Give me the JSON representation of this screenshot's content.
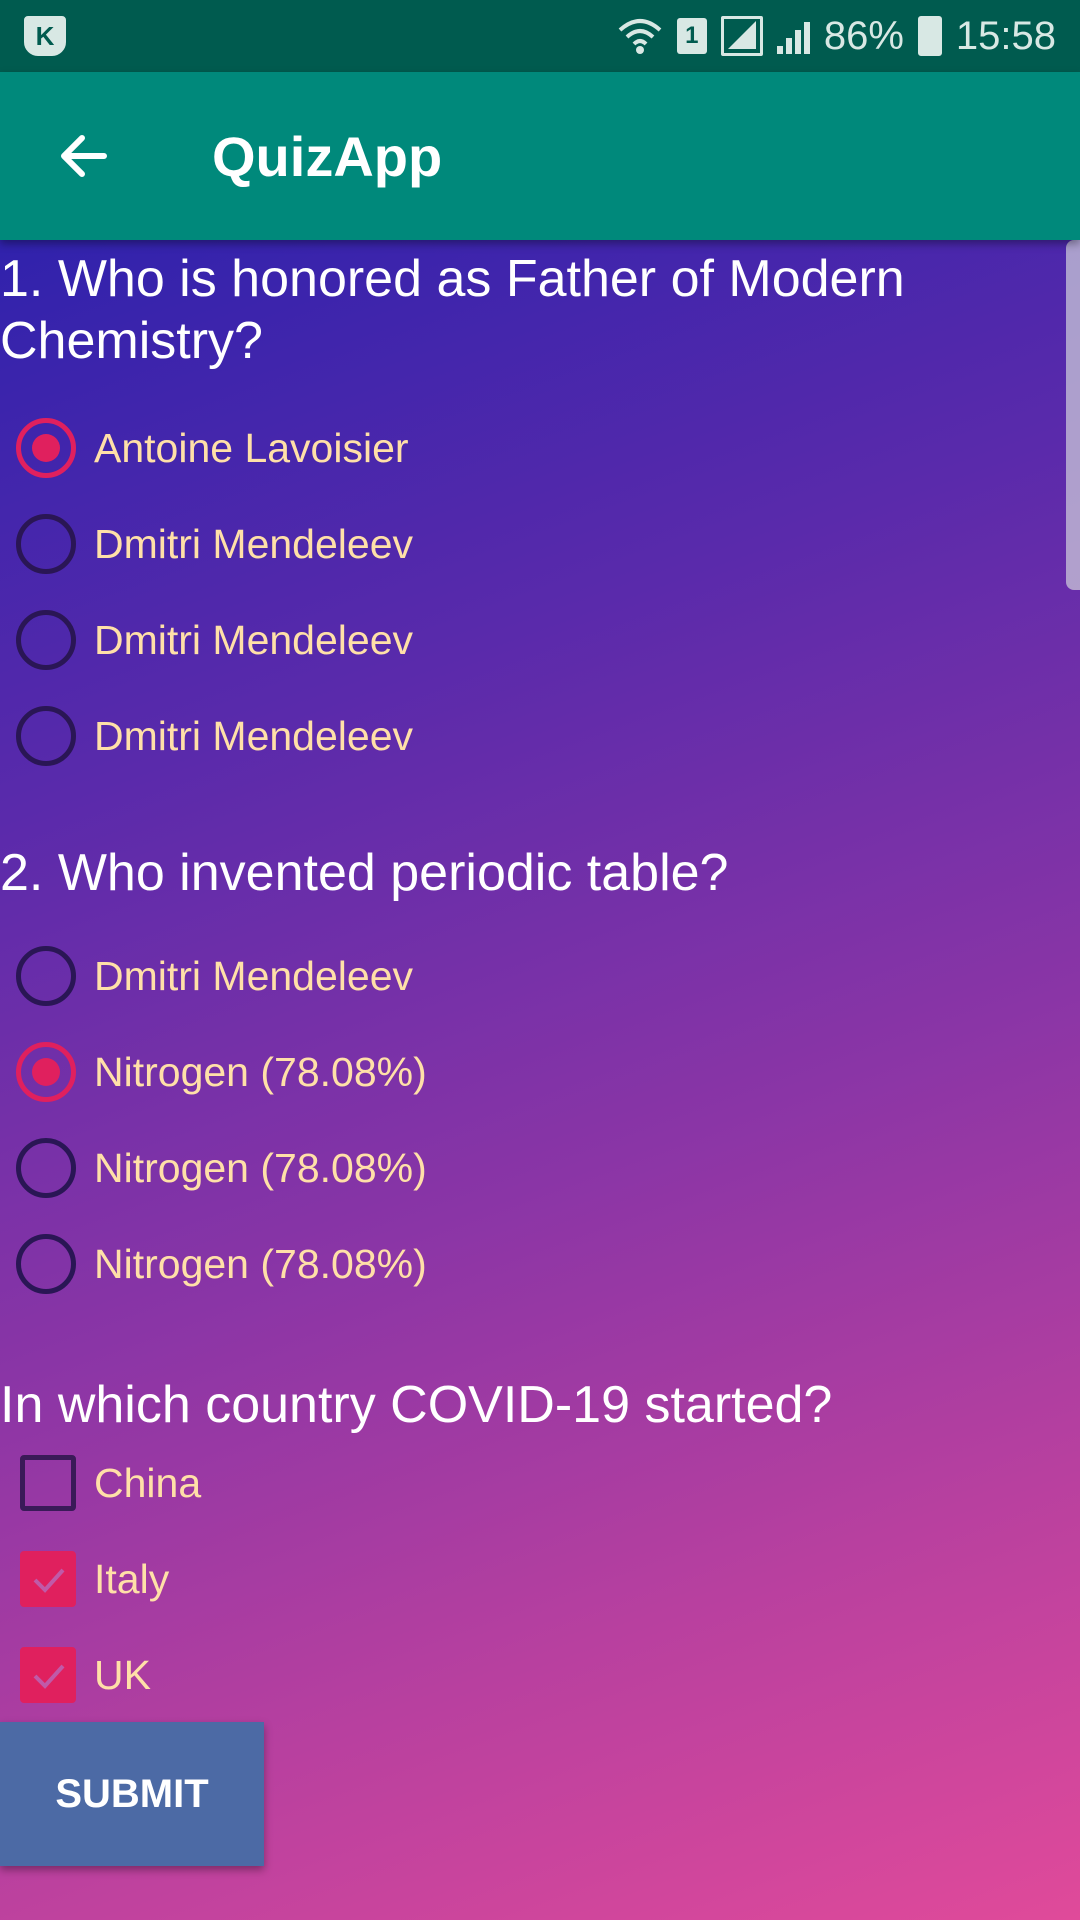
{
  "status_bar": {
    "sim_slot": "1",
    "battery": "86%",
    "time": "15:58",
    "icons": [
      "k-app-icon",
      "wifi-icon",
      "sim-icon",
      "signal-icon",
      "battery-icon"
    ]
  },
  "app_bar": {
    "title": "QuizApp",
    "back_icon": "arrow-left-icon"
  },
  "colors": {
    "status_bar": "#005b4f",
    "app_bar": "#00897b",
    "accent": "#e0205e",
    "option_text": "#ffe0a8",
    "submit_bg": "#4c6aa5"
  },
  "questions": [
    {
      "text": "1. Who is honored as Father of Modern Chemistry?",
      "type": "radio",
      "options": [
        {
          "label": "Antoine Lavoisier",
          "checked": true
        },
        {
          "label": "Dmitri Mendeleev",
          "checked": false
        },
        {
          "label": "Dmitri Mendeleev",
          "checked": false
        },
        {
          "label": "Dmitri Mendeleev",
          "checked": false
        }
      ]
    },
    {
      "text": "2. Who invented periodic table?",
      "type": "radio",
      "options": [
        {
          "label": "Dmitri Mendeleev",
          "checked": false
        },
        {
          "label": "Nitrogen (78.08%)",
          "checked": true
        },
        {
          "label": "Nitrogen (78.08%)",
          "checked": false
        },
        {
          "label": "Nitrogen (78.08%)",
          "checked": false
        }
      ]
    },
    {
      "text": "In which country COVID-19 started?",
      "type": "checkbox",
      "options": [
        {
          "label": "China",
          "checked": false
        },
        {
          "label": "Italy",
          "checked": true
        },
        {
          "label": "UK",
          "checked": true
        }
      ]
    }
  ],
  "submit_label": "SUBMIT"
}
